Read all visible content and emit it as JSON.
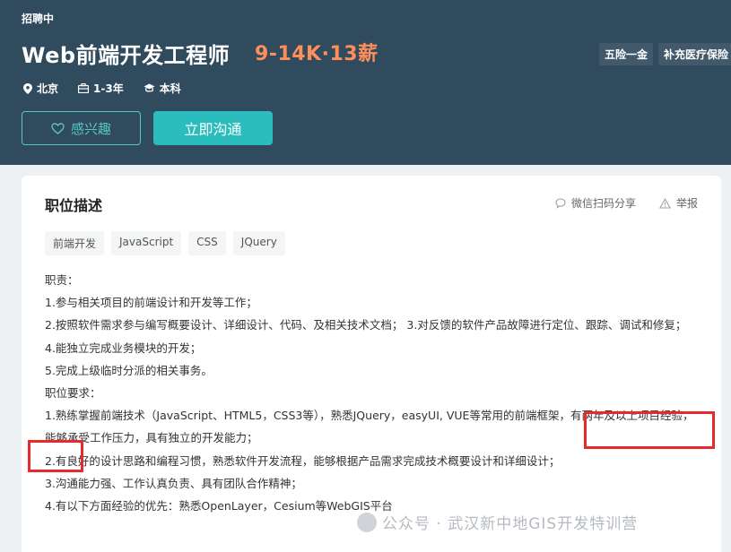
{
  "header": {
    "status": "招聘中",
    "title": "Web前端开发工程师",
    "salary": "9-14K·13薪",
    "welfare": [
      "五险一金",
      "补充医疗保险"
    ],
    "meta": {
      "location": "北京",
      "experience": "1-3年",
      "education": "本科"
    },
    "interest_label": "感兴趣",
    "chat_label": "立即沟通"
  },
  "card": {
    "title": "职位描述",
    "share_label": "微信扫码分享",
    "report_label": "举报",
    "skills": [
      "前端开发",
      "JavaScript",
      "CSS",
      "JQuery"
    ],
    "lines": [
      "职责：",
      "1.参与相关项目的前端设计和开发等工作；",
      " 2.按照软件需求参与编写概要设计、详细设计、代码、及相关技术文档； 3.对反馈的软件产品故障进行定位、跟踪、调试和修复；",
      " 4.能独立完成业务模块的开发；",
      " 5.完成上级临时分派的相关事务。",
      "职位要求：",
      "1.熟练掌握前端技术（JavaScript、HTML5，CSS3等），熟悉JQuery，easyUI, VUE等常用的前端框架，有两年及以上项目经验，能够承受工作压力，具有独立的开发能力；",
      "2.有良好的设计思路和编程习惯，熟悉软件开发流程，能够根据产品需求完成技术概要设计和详细设计；",
      "3.沟通能力强、工作认真负责、具有团队合作精神；",
      "4.有以下方面经验的优先：熟悉OpenLayer，Cesium等WebGIS平台"
    ]
  },
  "watermark": "公众号 · 武汉新中地GIS开发特训营",
  "colors": {
    "header_bg": "#304a5e",
    "salary": "#ff8f5a",
    "accent": "#2bbdbd",
    "highlight": "#e52b2b"
  },
  "icons": [
    "location-icon",
    "briefcase-icon",
    "graduation-cap-icon",
    "heart-icon",
    "chat-bubble-icon",
    "warning-icon"
  ]
}
